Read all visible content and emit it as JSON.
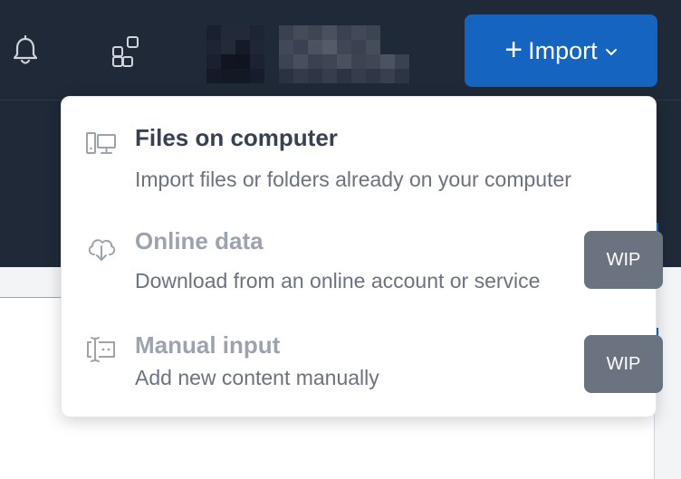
{
  "header": {
    "notifications_icon": "bell-icon",
    "apps_icon": "apps-icon",
    "import_button": {
      "label": "Import",
      "icon": "plus-icon",
      "caret": "chevron-down-icon",
      "color": "#1565c0"
    }
  },
  "import_menu": {
    "items": [
      {
        "icon": "computer-files-icon",
        "title": "Files on computer",
        "description": "Import files or folders already on your computer",
        "enabled": true
      },
      {
        "icon": "cloud-download-icon",
        "title": "Online data",
        "description": "Download from an online account or service",
        "enabled": false,
        "badge": "WIP"
      },
      {
        "icon": "text-input-icon",
        "title": "Manual input",
        "description": "Add new content manually",
        "enabled": false,
        "badge": "WIP"
      }
    ]
  },
  "colors": {
    "topbar": "#1f2937",
    "accent": "#1565c0",
    "badge": "#6b7280"
  }
}
